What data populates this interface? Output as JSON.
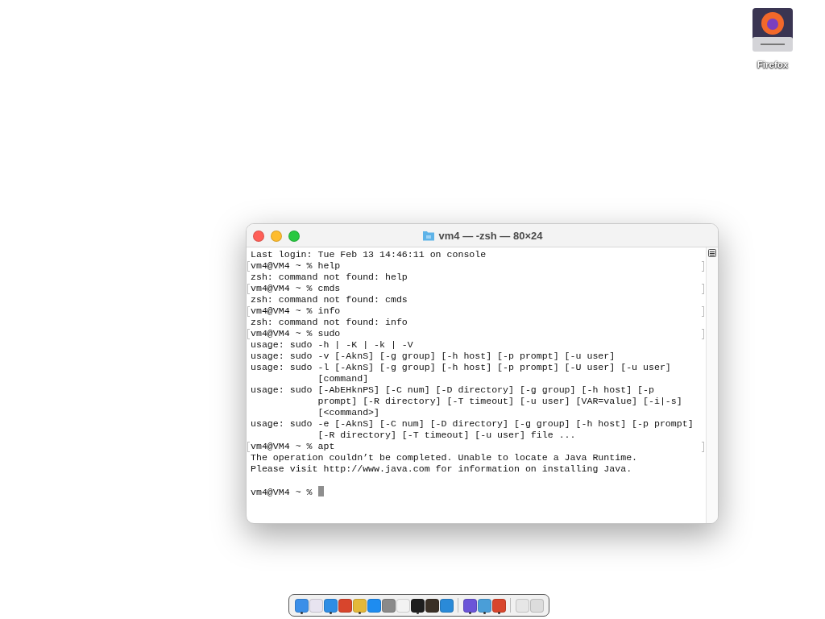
{
  "desktop_icons": [
    {
      "label": "Firefox"
    }
  ],
  "window": {
    "title": "vm4 — -zsh — 80×24",
    "lines": [
      {
        "kind": "output",
        "text": "Last login: Tue Feb 13 14:46:11 on console"
      },
      {
        "kind": "prompt",
        "text": "vm4@VM4 ~ % help"
      },
      {
        "kind": "output",
        "text": "zsh: command not found: help"
      },
      {
        "kind": "prompt",
        "text": "vm4@VM4 ~ % cmds"
      },
      {
        "kind": "output",
        "text": "zsh: command not found: cmds"
      },
      {
        "kind": "prompt",
        "text": "vm4@VM4 ~ % info"
      },
      {
        "kind": "output",
        "text": "zsh: command not found: info"
      },
      {
        "kind": "prompt",
        "text": "vm4@VM4 ~ % sudo"
      },
      {
        "kind": "output",
        "text": "usage: sudo -h | -K | -k | -V"
      },
      {
        "kind": "output",
        "text": "usage: sudo -v [-AknS] [-g group] [-h host] [-p prompt] [-u user]"
      },
      {
        "kind": "output",
        "text": "usage: sudo -l [-AknS] [-g group] [-h host] [-p prompt] [-U user] [-u user]"
      },
      {
        "kind": "output",
        "text": "            [command]"
      },
      {
        "kind": "output",
        "text": "usage: sudo [-AbEHknPS] [-C num] [-D directory] [-g group] [-h host] [-p"
      },
      {
        "kind": "output",
        "text": "            prompt] [-R directory] [-T timeout] [-u user] [VAR=value] [-i|-s]"
      },
      {
        "kind": "output",
        "text": "            [<command>]"
      },
      {
        "kind": "output",
        "text": "usage: sudo -e [-AknS] [-C num] [-D directory] [-g group] [-h host] [-p prompt]"
      },
      {
        "kind": "output",
        "text": "            [-R directory] [-T timeout] [-u user] file ..."
      },
      {
        "kind": "prompt",
        "text": "vm4@VM4 ~ % apt"
      },
      {
        "kind": "output",
        "text": "The operation couldn’t be completed. Unable to locate a Java Runtime."
      },
      {
        "kind": "output",
        "text": "Please visit http://www.java.com for information on installing Java."
      },
      {
        "kind": "blank"
      },
      {
        "kind": "input",
        "text": "vm4@VM4 ~ % "
      }
    ]
  },
  "dock": {
    "groups": [
      [
        {
          "color": "#3b8fe8",
          "running": true
        },
        {
          "color": "#e8e4f0",
          "running": false
        },
        {
          "color": "#2f8de4",
          "running": true
        },
        {
          "color": "#d8452c",
          "running": false
        },
        {
          "color": "#e4b83a",
          "running": true
        },
        {
          "color": "#1e8cf0",
          "running": false
        },
        {
          "color": "#8a8a8a",
          "running": false
        },
        {
          "color": "#f2f2f2",
          "running": false
        },
        {
          "color": "#1e1e1e",
          "running": true
        },
        {
          "color": "#3a3026",
          "running": false
        },
        {
          "color": "#2a8ad8",
          "running": false
        }
      ],
      [
        {
          "color": "#6b55d8",
          "running": true
        },
        {
          "color": "#4a9ed8",
          "running": true
        },
        {
          "color": "#d8452c",
          "running": true
        }
      ],
      [
        {
          "color": "#e6e6e6",
          "running": false
        },
        {
          "color": "#dcdcdc",
          "running": false
        }
      ]
    ]
  }
}
